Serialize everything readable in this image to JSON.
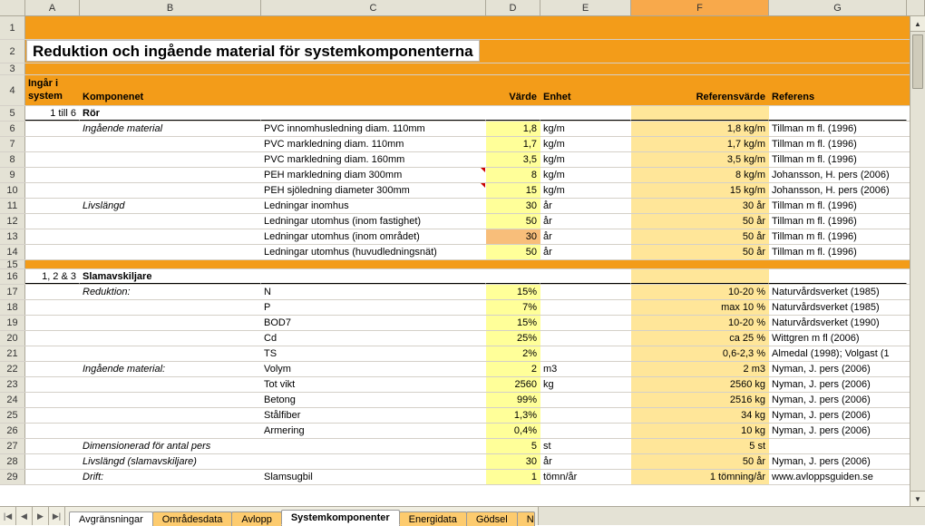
{
  "columns": [
    "A",
    "B",
    "C",
    "D",
    "E",
    "F",
    "G"
  ],
  "selectedColumn": "F",
  "title": "Reduktion och ingående material för systemkomponenterna",
  "headers": {
    "A": "Ingår i system",
    "B": "Komponenet",
    "D": "Värde",
    "E": "Enhet",
    "F": "Referensvärde",
    "G": "Referens"
  },
  "rows": [
    {
      "n": 5,
      "A": "1 till 6",
      "B": "Rör",
      "bBold": true,
      "under": true
    },
    {
      "n": 6,
      "B": "Ingående material",
      "bItalic": true,
      "C": "PVC innomhusledning diam. 110mm",
      "D": "1,8",
      "E": "kg/m",
      "F": "1,8 kg/m",
      "G": "Tillman m fl. (1996)"
    },
    {
      "n": 7,
      "C": "PVC markledning diam. 110mm",
      "D": "1,7",
      "E": "kg/m",
      "F": "1,7 kg/m",
      "G": "Tillman m fl. (1996)"
    },
    {
      "n": 8,
      "C": "PVC markledning diam. 160mm",
      "D": "3,5",
      "E": "kg/m",
      "F": "3,5 kg/m",
      "G": "Tillman m fl. (1996)"
    },
    {
      "n": 9,
      "C": "PEH markledning diam 300mm",
      "D": "8",
      "E": "kg/m",
      "F": "8 kg/m",
      "G": "Johansson, H. pers (2006)",
      "mark": true
    },
    {
      "n": 10,
      "C": "PEH sjöledning diameter 300mm",
      "D": "15",
      "E": "kg/m",
      "F": "15 kg/m",
      "G": "Johansson, H. pers (2006)",
      "mark": true
    },
    {
      "n": 11,
      "B": "Livslängd",
      "bItalic": true,
      "C": "Ledningar inomhus",
      "D": "30",
      "E": "år",
      "F": "30 år",
      "G": "Tillman m fl. (1996)"
    },
    {
      "n": 12,
      "C": "Ledningar utomhus (inom fastighet)",
      "D": "50",
      "E": "år",
      "F": "50 år",
      "G": "Tillman m fl. (1996)"
    },
    {
      "n": 13,
      "C": "Ledningar utomhus (inom området)",
      "D": "30",
      "E": "år",
      "F": "50 år",
      "G": "Tillman m fl. (1996)",
      "dOrange": true
    },
    {
      "n": 14,
      "C": "Ledningar utomhus (huvudledningsnät)",
      "D": "50",
      "E": "år",
      "F": "50 år",
      "G": "Tillman m fl. (1996)"
    },
    {
      "n": 15,
      "banner": true
    },
    {
      "n": 16,
      "A": "1, 2 & 3",
      "B": "Slamavskiljare",
      "bBold": true,
      "under": true
    },
    {
      "n": 17,
      "B": "Reduktion:",
      "bItalic": true,
      "C": "N",
      "D": "15%",
      "F": "10-20 %",
      "G": "Naturvårdsverket (1985)"
    },
    {
      "n": 18,
      "C": "P",
      "D": "7%",
      "F": "max 10 %",
      "G": "Naturvårdsverket (1985)"
    },
    {
      "n": 19,
      "C": "BOD7",
      "D": "15%",
      "F": "10-20 %",
      "G": "Naturvårdsverket (1990)"
    },
    {
      "n": 20,
      "C": "Cd",
      "D": "25%",
      "F": "ca 25 %",
      "G": "Wittgren m fl (2006)"
    },
    {
      "n": 21,
      "C": "TS",
      "D": "2%",
      "F": "0,6-2,3 %",
      "G": "Almedal (1998); Volgast (1"
    },
    {
      "n": 22,
      "B": "Ingående material:",
      "bItalic": true,
      "C": "Volym",
      "D": "2",
      "E": "m3",
      "F": "2 m3",
      "G": "Nyman, J. pers (2006)"
    },
    {
      "n": 23,
      "C": "Tot vikt",
      "D": "2560",
      "E": "kg",
      "F": "2560 kg",
      "G": "Nyman, J. pers (2006)"
    },
    {
      "n": 24,
      "C": "Betong",
      "D": "99%",
      "F": "2516 kg",
      "G": "Nyman, J. pers (2006)"
    },
    {
      "n": 25,
      "C": "Stålfiber",
      "D": "1,3%",
      "F": "34 kg",
      "G": "Nyman, J. pers (2006)"
    },
    {
      "n": 26,
      "C": "Armering",
      "D": "0,4%",
      "F": "10 kg",
      "G": "Nyman, J. pers (2006)"
    },
    {
      "n": 27,
      "B": "Dimensionerad för antal pers",
      "bItalic": true,
      "D": "5",
      "E": "st",
      "F": "5 st"
    },
    {
      "n": 28,
      "B": "Livslängd (slamavskiljare)",
      "bItalic": true,
      "D": "30",
      "E": "år",
      "F": "50 år",
      "G": "Nyman, J. pers (2006)"
    },
    {
      "n": 29,
      "B": "Drift:",
      "bItalic": true,
      "C": "Slamsugbil",
      "D": "1",
      "E": "tömn/år",
      "F": "1 tömning/år",
      "G": "www.avloppsguiden.se"
    }
  ],
  "tabs": [
    {
      "label": "Avgränsningar",
      "color": "white"
    },
    {
      "label": "Områdesdata",
      "color": "y"
    },
    {
      "label": "Avlopp",
      "color": "y"
    },
    {
      "label": "Systemkomponenter",
      "color": "active"
    },
    {
      "label": "Energidata",
      "color": "y"
    },
    {
      "label": "Gödsel",
      "color": "y"
    },
    {
      "label": "N",
      "color": "y",
      "clip": true
    }
  ],
  "nav": {
    "first": "|◀",
    "prev": "◀",
    "next": "▶",
    "last": "▶|"
  },
  "scroll": {
    "up": "▲",
    "down": "▼"
  }
}
